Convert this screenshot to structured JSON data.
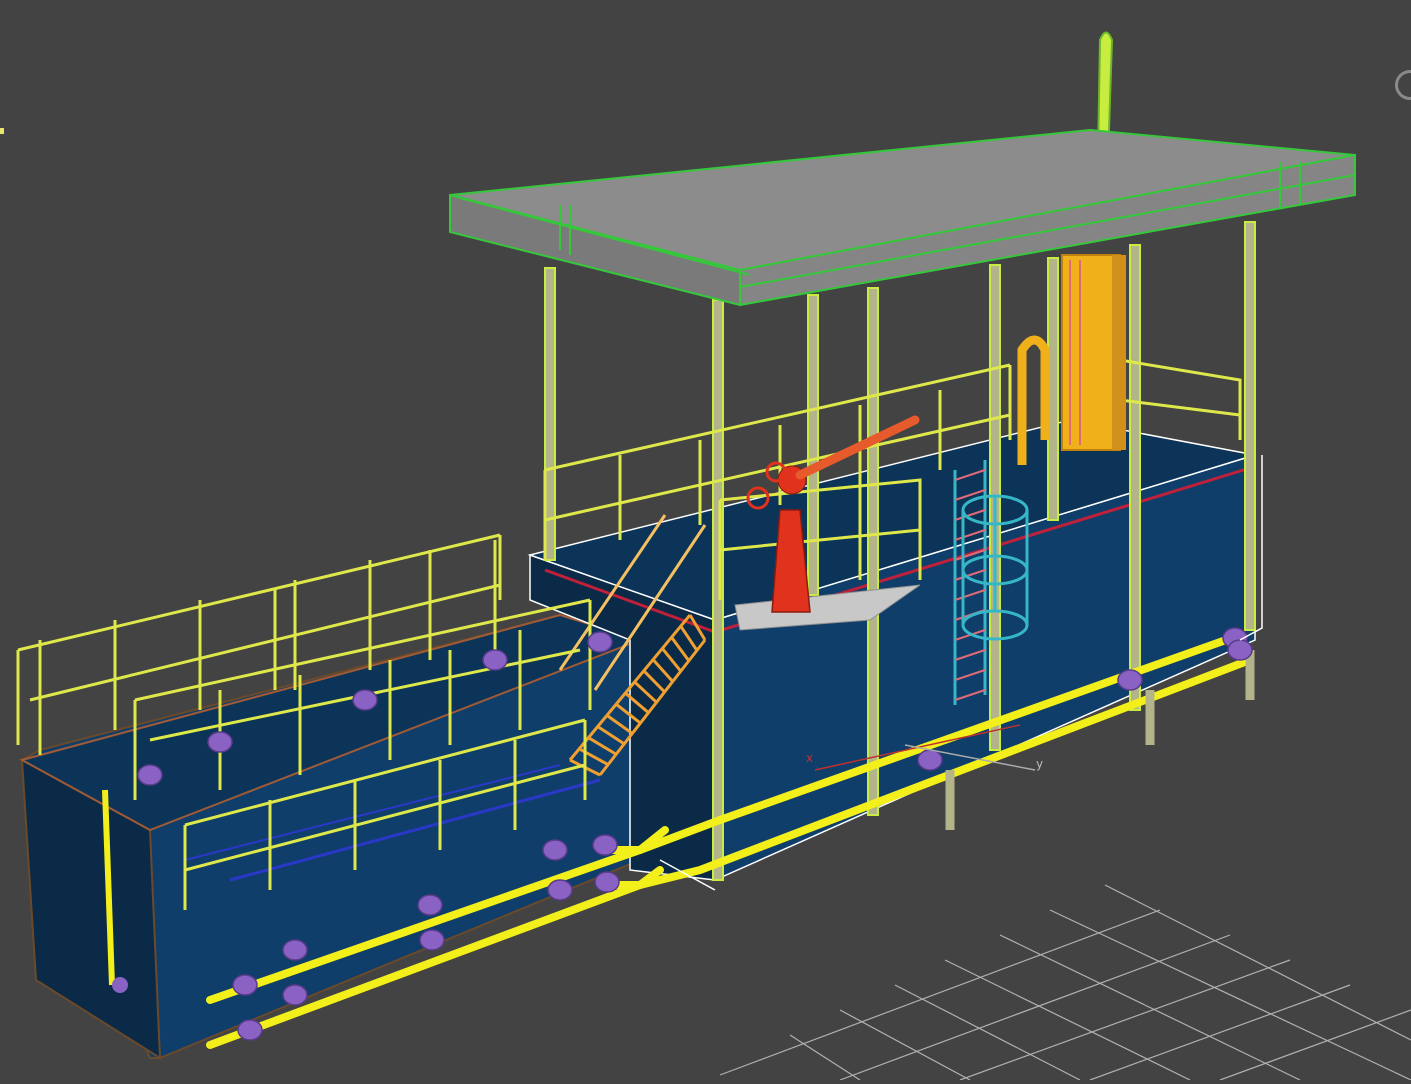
{
  "viewport": {
    "view": "Perspective",
    "background_color": "#434343",
    "shading": "wireframe-over-shaded"
  },
  "axis_gizmo": {
    "x_label": "x",
    "y_label": "y"
  },
  "colors": {
    "tank_fill": "#0f3e6a",
    "tank_dark": "#0a2a47",
    "roof_fill": "#8c8c8c",
    "roof_edge": "#35c83a",
    "railing": "#dfe84a",
    "pipe": "#f2ef1a",
    "flange": "#8a62c4",
    "column": "#b4b48a",
    "column_edge": "#c9ec41",
    "monitor": "#e0321c",
    "ladder": "#36b7c8",
    "stack": "#f0b01a",
    "selection_box": "#ffffff",
    "grid": "#bdbdbd"
  },
  "objects": [
    "roof-canopy",
    "exhaust-stack",
    "upper-tank",
    "lower-tank",
    "fire-monitor",
    "cage-ladder",
    "stair",
    "pipe-rack",
    "railings",
    "support-columns"
  ]
}
